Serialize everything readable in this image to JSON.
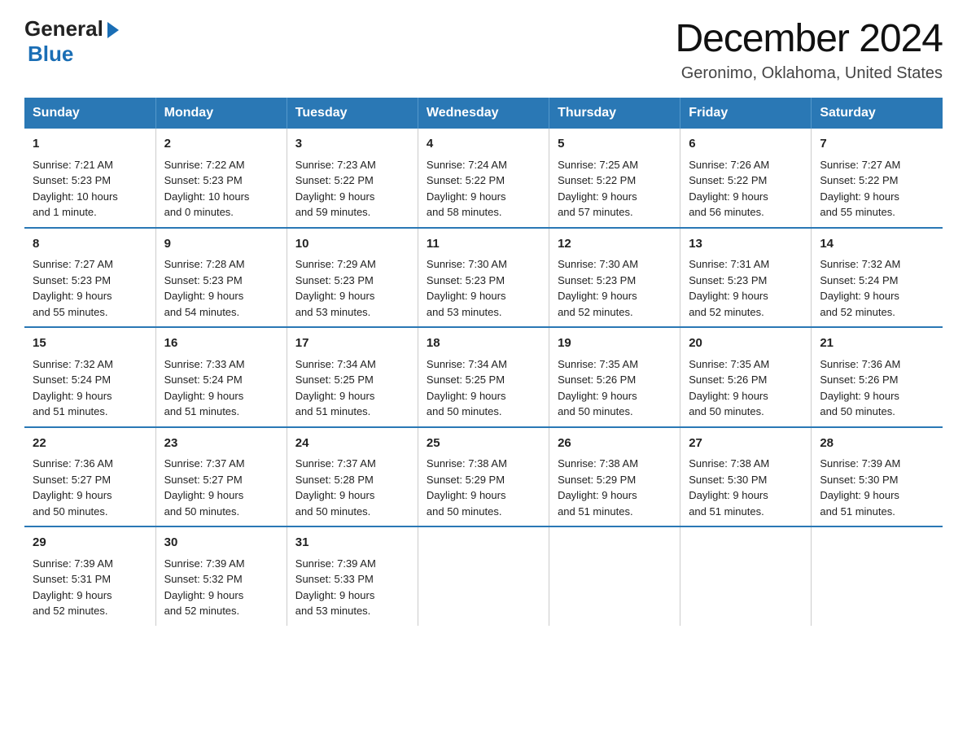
{
  "header": {
    "logo_general": "General",
    "logo_blue": "Blue",
    "month_title": "December 2024",
    "location": "Geronimo, Oklahoma, United States"
  },
  "weekdays": [
    "Sunday",
    "Monday",
    "Tuesday",
    "Wednesday",
    "Thursday",
    "Friday",
    "Saturday"
  ],
  "weeks": [
    [
      {
        "day": "1",
        "sunrise": "7:21 AM",
        "sunset": "5:23 PM",
        "daylight": "10 hours and 1 minute."
      },
      {
        "day": "2",
        "sunrise": "7:22 AM",
        "sunset": "5:23 PM",
        "daylight": "10 hours and 0 minutes."
      },
      {
        "day": "3",
        "sunrise": "7:23 AM",
        "sunset": "5:22 PM",
        "daylight": "9 hours and 59 minutes."
      },
      {
        "day": "4",
        "sunrise": "7:24 AM",
        "sunset": "5:22 PM",
        "daylight": "9 hours and 58 minutes."
      },
      {
        "day": "5",
        "sunrise": "7:25 AM",
        "sunset": "5:22 PM",
        "daylight": "9 hours and 57 minutes."
      },
      {
        "day": "6",
        "sunrise": "7:26 AM",
        "sunset": "5:22 PM",
        "daylight": "9 hours and 56 minutes."
      },
      {
        "day": "7",
        "sunrise": "7:27 AM",
        "sunset": "5:22 PM",
        "daylight": "9 hours and 55 minutes."
      }
    ],
    [
      {
        "day": "8",
        "sunrise": "7:27 AM",
        "sunset": "5:23 PM",
        "daylight": "9 hours and 55 minutes."
      },
      {
        "day": "9",
        "sunrise": "7:28 AM",
        "sunset": "5:23 PM",
        "daylight": "9 hours and 54 minutes."
      },
      {
        "day": "10",
        "sunrise": "7:29 AM",
        "sunset": "5:23 PM",
        "daylight": "9 hours and 53 minutes."
      },
      {
        "day": "11",
        "sunrise": "7:30 AM",
        "sunset": "5:23 PM",
        "daylight": "9 hours and 53 minutes."
      },
      {
        "day": "12",
        "sunrise": "7:30 AM",
        "sunset": "5:23 PM",
        "daylight": "9 hours and 52 minutes."
      },
      {
        "day": "13",
        "sunrise": "7:31 AM",
        "sunset": "5:23 PM",
        "daylight": "9 hours and 52 minutes."
      },
      {
        "day": "14",
        "sunrise": "7:32 AM",
        "sunset": "5:24 PM",
        "daylight": "9 hours and 52 minutes."
      }
    ],
    [
      {
        "day": "15",
        "sunrise": "7:32 AM",
        "sunset": "5:24 PM",
        "daylight": "9 hours and 51 minutes."
      },
      {
        "day": "16",
        "sunrise": "7:33 AM",
        "sunset": "5:24 PM",
        "daylight": "9 hours and 51 minutes."
      },
      {
        "day": "17",
        "sunrise": "7:34 AM",
        "sunset": "5:25 PM",
        "daylight": "9 hours and 51 minutes."
      },
      {
        "day": "18",
        "sunrise": "7:34 AM",
        "sunset": "5:25 PM",
        "daylight": "9 hours and 50 minutes."
      },
      {
        "day": "19",
        "sunrise": "7:35 AM",
        "sunset": "5:26 PM",
        "daylight": "9 hours and 50 minutes."
      },
      {
        "day": "20",
        "sunrise": "7:35 AM",
        "sunset": "5:26 PM",
        "daylight": "9 hours and 50 minutes."
      },
      {
        "day": "21",
        "sunrise": "7:36 AM",
        "sunset": "5:26 PM",
        "daylight": "9 hours and 50 minutes."
      }
    ],
    [
      {
        "day": "22",
        "sunrise": "7:36 AM",
        "sunset": "5:27 PM",
        "daylight": "9 hours and 50 minutes."
      },
      {
        "day": "23",
        "sunrise": "7:37 AM",
        "sunset": "5:27 PM",
        "daylight": "9 hours and 50 minutes."
      },
      {
        "day": "24",
        "sunrise": "7:37 AM",
        "sunset": "5:28 PM",
        "daylight": "9 hours and 50 minutes."
      },
      {
        "day": "25",
        "sunrise": "7:38 AM",
        "sunset": "5:29 PM",
        "daylight": "9 hours and 50 minutes."
      },
      {
        "day": "26",
        "sunrise": "7:38 AM",
        "sunset": "5:29 PM",
        "daylight": "9 hours and 51 minutes."
      },
      {
        "day": "27",
        "sunrise": "7:38 AM",
        "sunset": "5:30 PM",
        "daylight": "9 hours and 51 minutes."
      },
      {
        "day": "28",
        "sunrise": "7:39 AM",
        "sunset": "5:30 PM",
        "daylight": "9 hours and 51 minutes."
      }
    ],
    [
      {
        "day": "29",
        "sunrise": "7:39 AM",
        "sunset": "5:31 PM",
        "daylight": "9 hours and 52 minutes."
      },
      {
        "day": "30",
        "sunrise": "7:39 AM",
        "sunset": "5:32 PM",
        "daylight": "9 hours and 52 minutes."
      },
      {
        "day": "31",
        "sunrise": "7:39 AM",
        "sunset": "5:33 PM",
        "daylight": "9 hours and 53 minutes."
      },
      null,
      null,
      null,
      null
    ]
  ],
  "labels": {
    "sunrise": "Sunrise:",
    "sunset": "Sunset:",
    "daylight": "Daylight:"
  }
}
